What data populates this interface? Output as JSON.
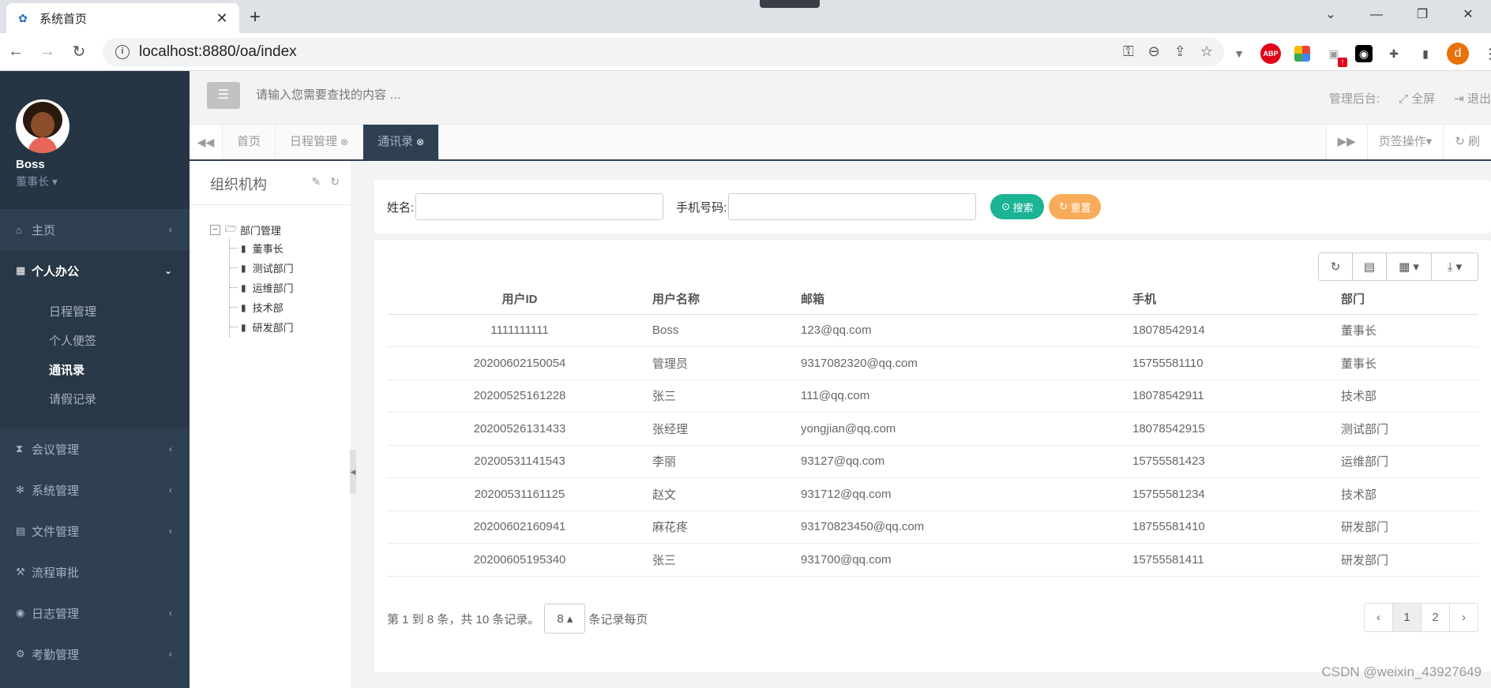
{
  "browser": {
    "tab_title": "系统首页",
    "url": "localhost:8880/oa/index",
    "ext_abp": "ABP",
    "ext_badge": "!",
    "profile_initial": "d"
  },
  "sidebar": {
    "user_name": "Boss",
    "user_role": "董事长 ▾",
    "menu": [
      {
        "label": "主页",
        "icon": "home-icon",
        "glyph": "⌂"
      },
      {
        "label": "个人办公",
        "icon": "calendar-icon",
        "glyph": "▦"
      },
      {
        "label": "会议管理",
        "icon": "hourglass-icon",
        "glyph": "⧗"
      },
      {
        "label": "系统管理",
        "icon": "gear-icon",
        "glyph": "✻"
      },
      {
        "label": "文件管理",
        "icon": "file-icon",
        "glyph": "▤"
      },
      {
        "label": "流程审批",
        "icon": "gavel-icon",
        "glyph": "⚒"
      },
      {
        "label": "日志管理",
        "icon": "eye-icon",
        "glyph": "◉"
      },
      {
        "label": "考勤管理",
        "icon": "gears-icon",
        "glyph": "⚙"
      }
    ],
    "submenu": [
      "日程管理",
      "个人便签",
      "通讯录",
      "请假记录"
    ]
  },
  "header": {
    "search_placeholder": "请输入您需要查找的内容 …",
    "admin_label": "管理后台:",
    "fullscreen_label": "全屏",
    "logout_label": "退出"
  },
  "tabs": {
    "items": [
      "首页",
      "日程管理",
      "通讯录"
    ],
    "tab_ops": "页签操作▾",
    "refresh": "刷"
  },
  "org": {
    "title": "组织机构",
    "root": "部门管理",
    "children": [
      "董事长",
      "测试部门",
      "运维部门",
      "技术部",
      "研发部门"
    ]
  },
  "search": {
    "name_label": "姓名:",
    "phone_label": "手机号码:",
    "search_btn": "搜索",
    "reset_btn": "重置"
  },
  "table": {
    "columns": [
      "用户ID",
      "用户名称",
      "邮箱",
      "手机",
      "部门"
    ],
    "rows": [
      [
        "1111111111",
        "Boss",
        "123@qq.com",
        "18078542914",
        "董事长"
      ],
      [
        "20200602150054",
        "管理员",
        "9317082320@qq.com",
        "15755581110",
        "董事长"
      ],
      [
        "20200525161228",
        "张三",
        "111@qq.com",
        "18078542911",
        "技术部"
      ],
      [
        "20200526131433",
        "张经理",
        "yongjian@qq.com",
        "18078542915",
        "测试部门"
      ],
      [
        "20200531141543",
        "李丽",
        "93127@qq.com",
        "15755581423",
        "运维部门"
      ],
      [
        "20200531161125",
        "赵文",
        "931712@qq.com",
        "15755581234",
        "技术部"
      ],
      [
        "20200602160941",
        "麻花疼",
        "93170823450@qq.com",
        "18755581410",
        "研发部门"
      ],
      [
        "20200605195340",
        "张三",
        "931700@qq.com",
        "15755581411",
        "研发部门"
      ]
    ],
    "pager_text": "第 1 到 8 条，共 10 条记录。",
    "page_size": "8 ▴",
    "page_size_suffix": "条记录每页",
    "pages": [
      "‹",
      "1",
      "2",
      "›"
    ]
  },
  "watermark": "CSDN @weixin_43927649",
  "colors": {
    "sidebar_bg": "#2f4050",
    "search_green": "#1ab394",
    "reset_orange": "#f8ac59"
  }
}
